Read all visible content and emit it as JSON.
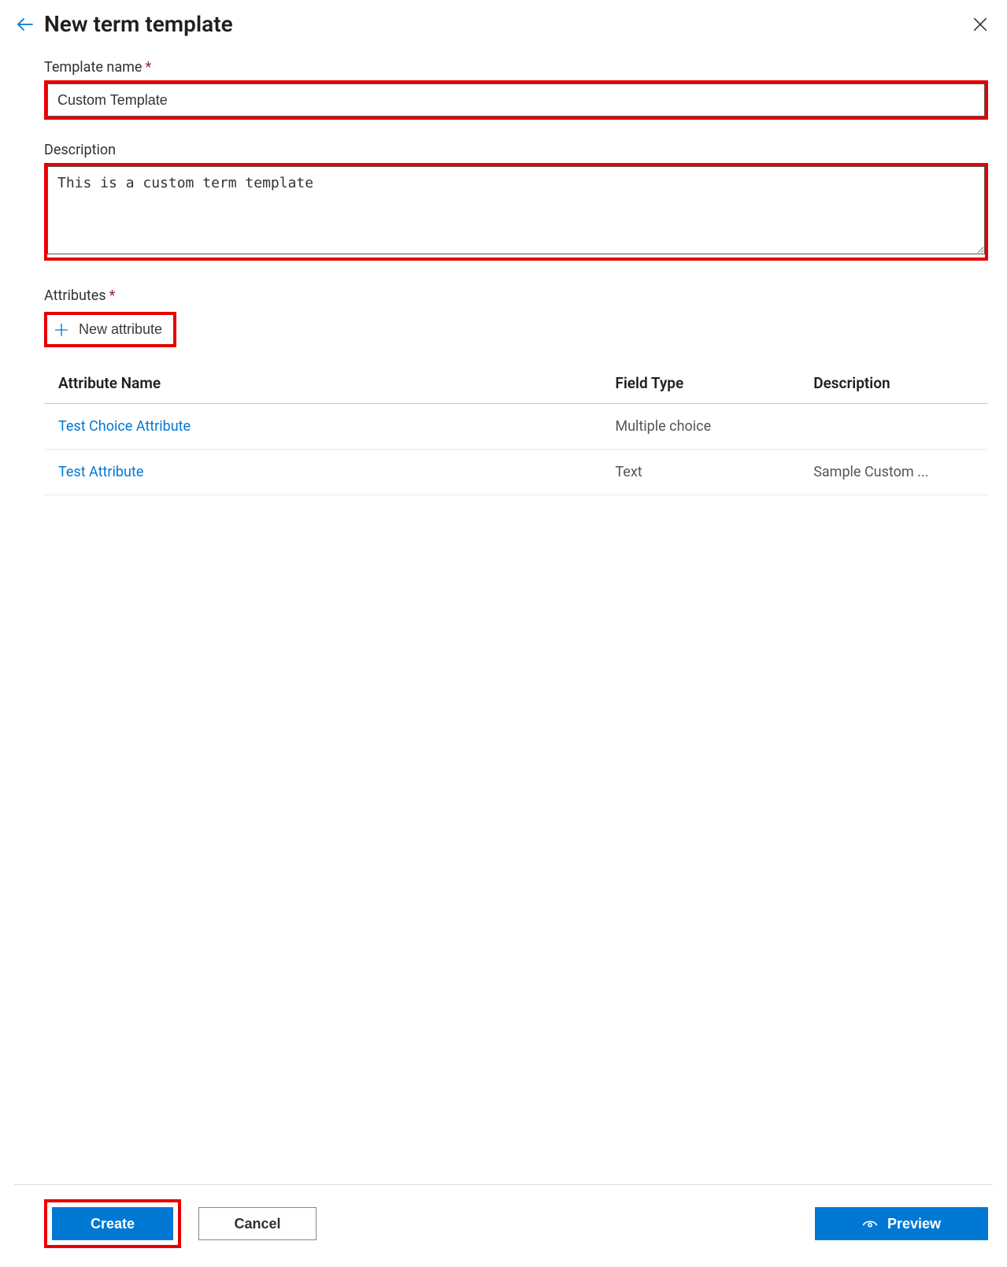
{
  "header": {
    "title": "New term template"
  },
  "form": {
    "template_name_label": "Template name",
    "template_name_value": "Custom Template",
    "description_label": "Description",
    "description_value": "This is a custom term template",
    "attributes_label": "Attributes",
    "new_attribute_label": "New attribute"
  },
  "table": {
    "columns": {
      "name": "Attribute Name",
      "type": "Field Type",
      "desc": "Description"
    },
    "rows": [
      {
        "name": "Test Choice Attribute",
        "type": "Multiple choice",
        "desc": ""
      },
      {
        "name": "Test Attribute",
        "type": "Text",
        "desc": "Sample Custom ..."
      }
    ]
  },
  "footer": {
    "create": "Create",
    "cancel": "Cancel",
    "preview": "Preview"
  }
}
